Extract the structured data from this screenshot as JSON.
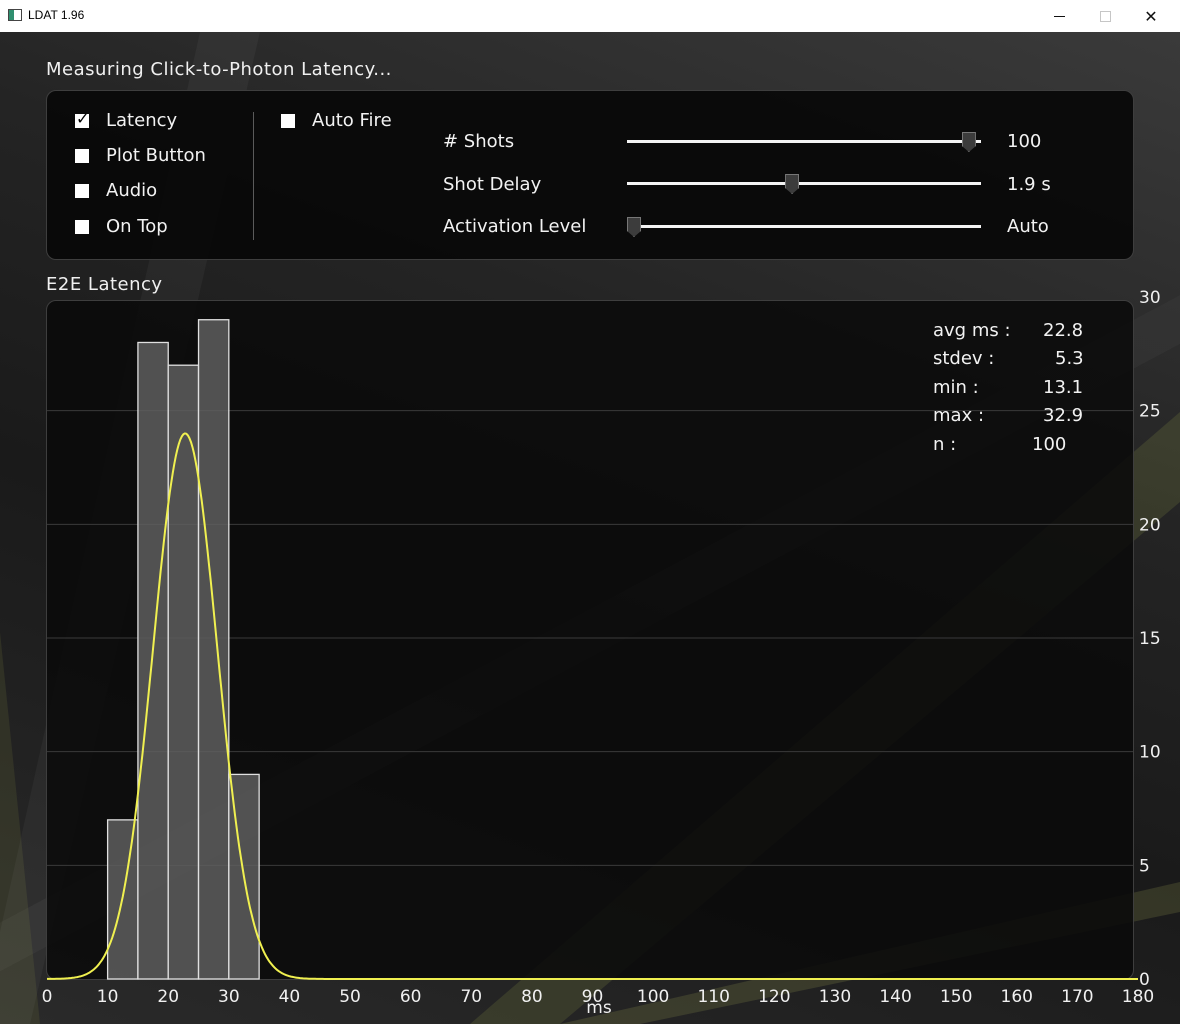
{
  "window": {
    "title": "LDAT 1.96",
    "minimize_icon": "minimize-icon",
    "maximize_icon": "maximize-icon",
    "close_icon": "close-icon"
  },
  "status_heading": "Measuring  Click-to-Photon  Latency...",
  "options": [
    {
      "label": "Latency",
      "checked": true
    },
    {
      "label": "Plot  Button",
      "checked": false
    },
    {
      "label": "Audio",
      "checked": false
    },
    {
      "label": "On  Top",
      "checked": false
    }
  ],
  "auto_fire": {
    "label": "Auto  Fire",
    "checked": false
  },
  "sliders": [
    {
      "label": "#  Shots",
      "value_text": "100",
      "level": 0.985
    },
    {
      "label": "Shot  Delay",
      "value_text": "1.9  s",
      "level": 0.465
    },
    {
      "label": "Activation  Level",
      "value_text": "Auto",
      "level": 0.0
    }
  ],
  "chart_section_title": "E2E  Latency",
  "stats": [
    {
      "label": "avg  ms  :",
      "value": "22.8"
    },
    {
      "label": "stdev  :",
      "value": "5.3"
    },
    {
      "label": "min  :",
      "value": "13.1"
    },
    {
      "label": "max  :",
      "value": "32.9"
    },
    {
      "label": "n  :",
      "value": "100"
    }
  ],
  "colors": {
    "bar_fill": "#5e5e5e",
    "bar_stroke": "#e0e0e0",
    "curve": "#f0f050",
    "grid": "#3a3a3a"
  },
  "chart_data": {
    "type": "bar",
    "xlabel": "ms",
    "ylabel": "",
    "xlim": [
      0,
      180
    ],
    "ylim": [
      0,
      30
    ],
    "x_ticks": [
      0,
      10,
      20,
      30,
      40,
      50,
      60,
      70,
      80,
      90,
      100,
      110,
      120,
      130,
      140,
      150,
      160,
      170,
      180
    ],
    "y_ticks": [
      0,
      5,
      10,
      15,
      20,
      25,
      30
    ],
    "bins": [
      {
        "start": 10,
        "end": 15,
        "count": 7
      },
      {
        "start": 15,
        "end": 20,
        "count": 28
      },
      {
        "start": 20,
        "end": 25,
        "count": 27
      },
      {
        "start": 25,
        "end": 30,
        "count": 29
      },
      {
        "start": 30,
        "end": 35,
        "count": 9
      }
    ],
    "fit_curve": {
      "type": "normal",
      "mean": 22.8,
      "stdev": 5.3,
      "peak": 24
    },
    "grid": true
  }
}
